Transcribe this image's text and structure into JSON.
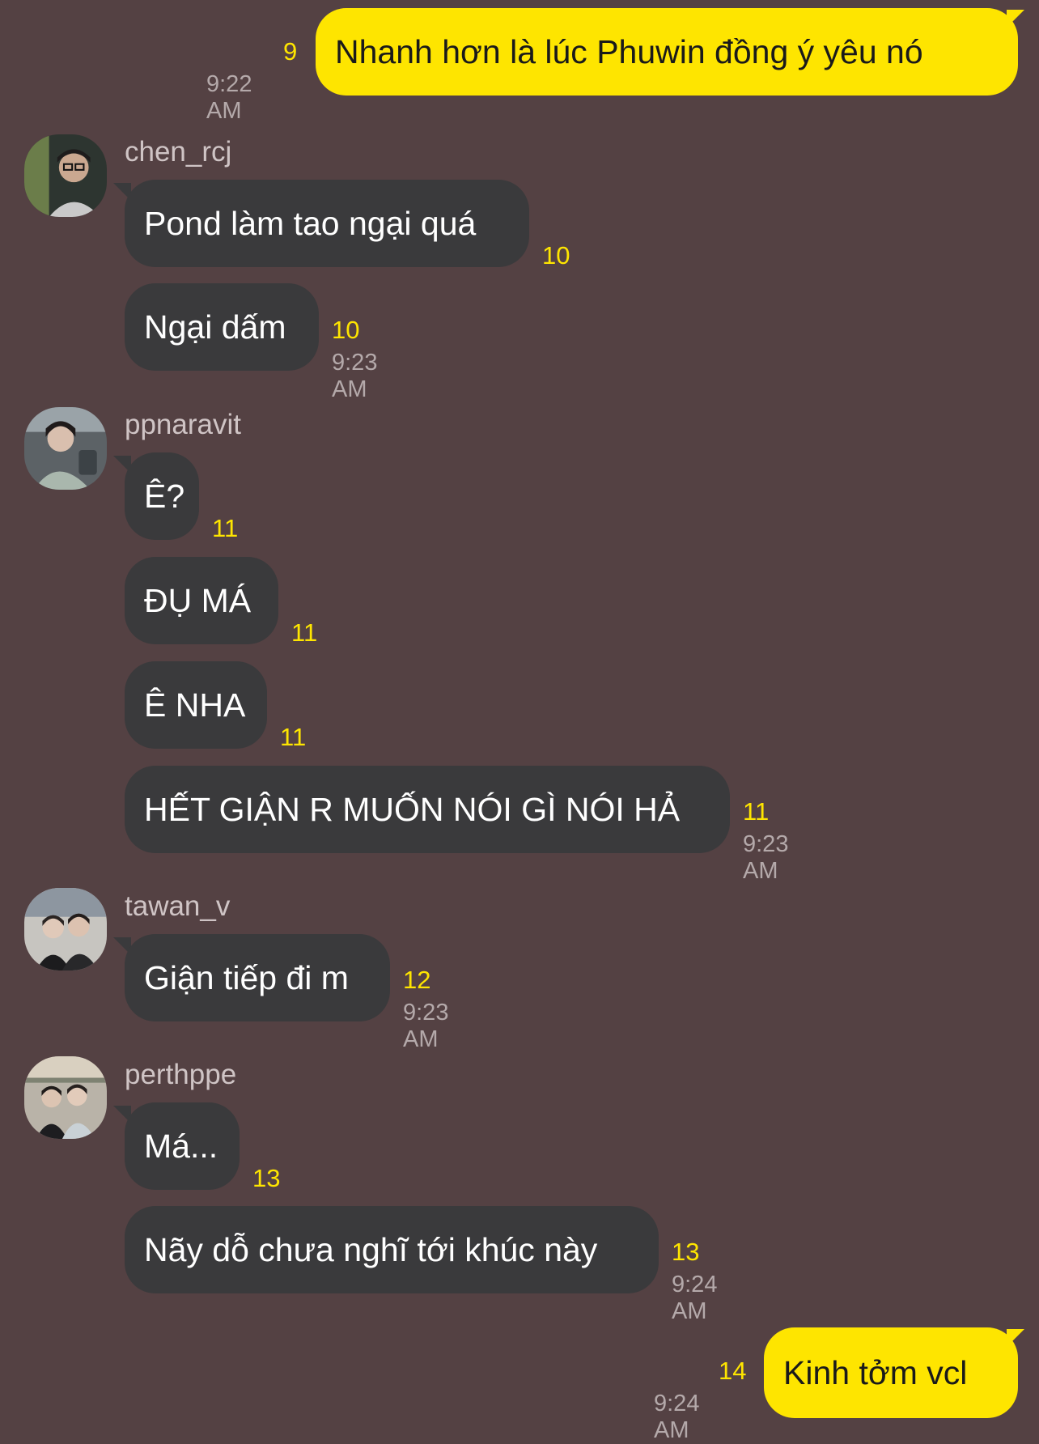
{
  "messages": [
    {
      "type": "outgoing",
      "text": "Nhanh hơn là lúc Phuwin đồng ý yêu nó",
      "count": "9",
      "time": "9:22 AM"
    },
    {
      "type": "sender",
      "name": "chen_rcj",
      "avatar_icon": "user-avatar-icon"
    },
    {
      "type": "incoming",
      "text": "Pond làm tao ngại quá",
      "count": "10"
    },
    {
      "type": "incoming",
      "text": "Ngại dấm",
      "count": "10",
      "time": "9:23 AM"
    },
    {
      "type": "sender",
      "name": "ppnaravit",
      "avatar_icon": "user-avatar-icon"
    },
    {
      "type": "incoming",
      "text": "Ê?",
      "count": "11"
    },
    {
      "type": "incoming",
      "text": "ĐỤ MÁ",
      "count": "11"
    },
    {
      "type": "incoming",
      "text": "Ê NHA",
      "count": "11"
    },
    {
      "type": "incoming",
      "text": "HẾT GIẬN R MUỐN NÓI GÌ NÓI HẢ",
      "count": "11",
      "time": "9:23 AM"
    },
    {
      "type": "sender",
      "name": "tawan_v",
      "avatar_icon": "user-avatar-icon"
    },
    {
      "type": "incoming",
      "text": "Giận tiếp đi m",
      "count": "12",
      "time": "9:23 AM"
    },
    {
      "type": "sender",
      "name": "perthppe",
      "avatar_icon": "user-avatar-icon"
    },
    {
      "type": "incoming",
      "text": "Má...",
      "count": "13"
    },
    {
      "type": "incoming",
      "text": "Nãy dỗ chưa nghĩ tới khúc này",
      "count": "13",
      "time": "9:24 AM"
    },
    {
      "type": "outgoing",
      "text": "Kinh tởm vcl",
      "count": "14",
      "time": "9:24 AM"
    }
  ],
  "colors": {
    "background": "#544143",
    "incoming_bubble": "#3a3a3c",
    "outgoing_bubble": "#fee500",
    "unread_count": "#fee500",
    "timestamp": "#b4a9aa"
  }
}
